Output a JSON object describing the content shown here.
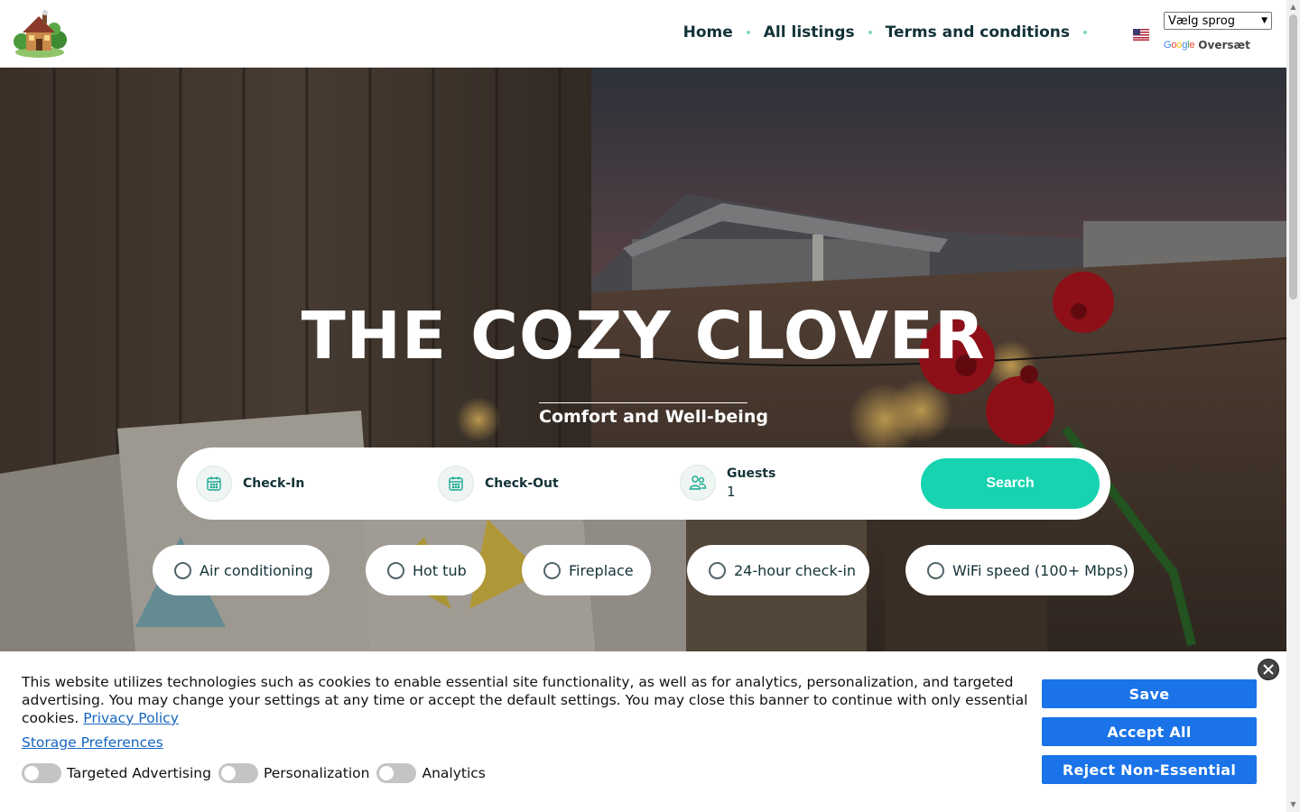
{
  "header": {
    "logo_name": "house-logo",
    "nav": [
      {
        "label": "Home"
      },
      {
        "label": "All listings"
      },
      {
        "label": "Terms and conditions"
      }
    ],
    "language_select": "Vælg sprog",
    "google_word": "Google",
    "translate_label": "Oversæt"
  },
  "hero": {
    "title": "THE COZY CLOVER",
    "subtitle": "Comfort and Well-being",
    "search": {
      "checkin_label": "Check-In",
      "checkout_label": "Check-Out",
      "guests_label": "Guests",
      "guests_value": "1",
      "search_button": "Search"
    },
    "amenities": [
      {
        "label": "Air conditioning"
      },
      {
        "label": "Hot tub"
      },
      {
        "label": "Fireplace"
      },
      {
        "label": "24-hour check-in"
      },
      {
        "label": "WiFi speed (100+ Mbps)"
      }
    ]
  },
  "cookie_banner": {
    "text": "This website utilizes technologies such as cookies to enable essential site functionality, as well as for analytics, personalization, and targeted advertising. You may change your settings at any time or accept the default settings. You may close this banner to continue with only essential cookies.",
    "privacy_link": "Privacy Policy",
    "storage_link": "Storage Preferences",
    "toggles": [
      {
        "label": "Targeted Advertising",
        "on": false
      },
      {
        "label": "Personalization",
        "on": false
      },
      {
        "label": "Analytics",
        "on": false
      }
    ],
    "save_button": "Save",
    "accept_button": "Accept All",
    "reject_button": "Reject Non-Essential"
  },
  "colors": {
    "accent": "#17d3b0",
    "nav_text": "#133238",
    "cookie_button": "#1a73e8",
    "link": "#1565c0"
  }
}
